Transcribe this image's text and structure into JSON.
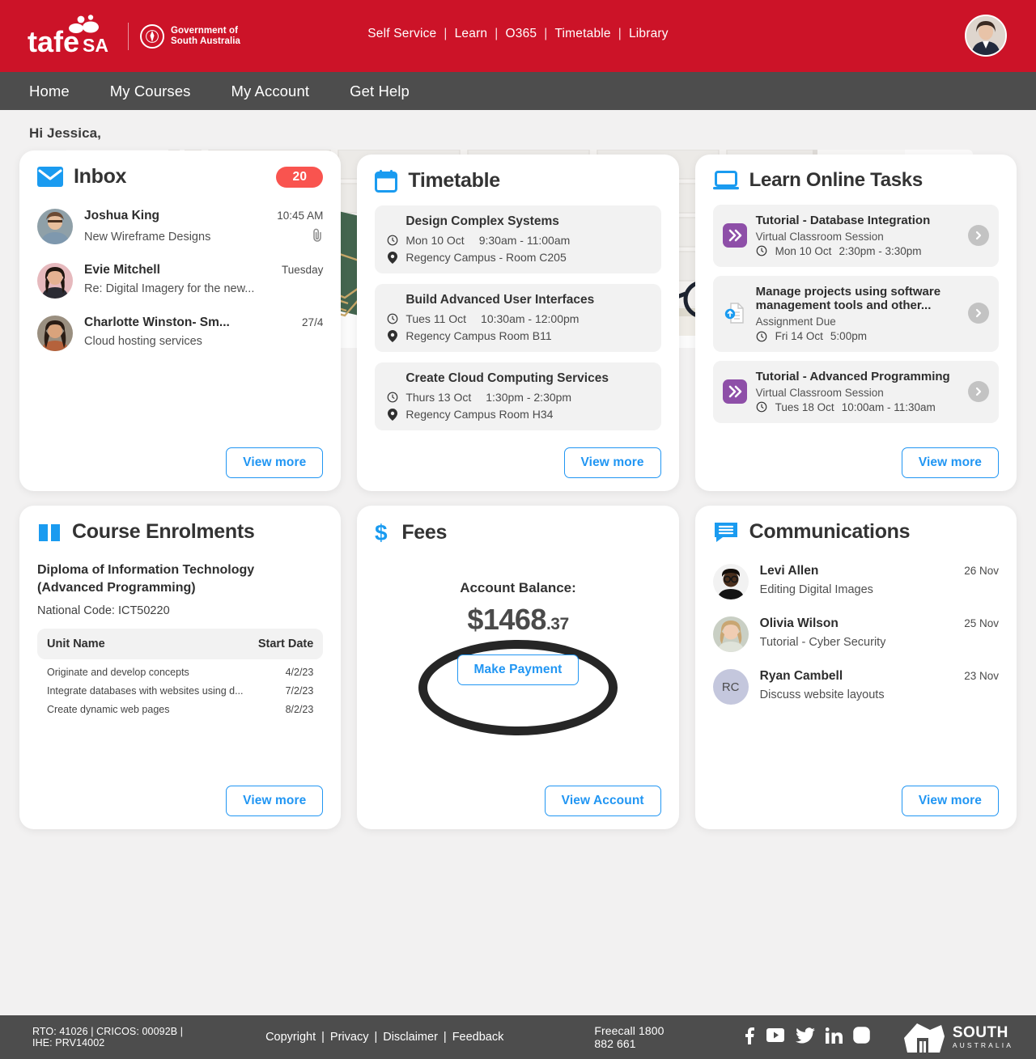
{
  "header": {
    "brand_name": "tafeSA",
    "gov_line1": "Government of",
    "gov_line2": "South Australia",
    "brand_red": "#cc1328",
    "quicklinks": [
      "Self Service",
      "Learn",
      "O365",
      "Timetable",
      "Library"
    ],
    "separator": "|",
    "avatar_icon": "user-avatar"
  },
  "nav": {
    "items": [
      "Home",
      "My Courses",
      "My Account",
      "Get Help"
    ]
  },
  "page": {
    "greeting": "Hi Jessica,"
  },
  "inbox": {
    "title": "Inbox",
    "icon": "envelope-icon",
    "badge": "20",
    "badge_color": "#f9544f",
    "messages": [
      {
        "name": "Joshua King",
        "subject": "New Wireframe Designs",
        "time": "10:45 AM",
        "attachment": true
      },
      {
        "name": "Evie Mitchell",
        "subject": "Re: Digital Imagery for the new...",
        "time": "Tuesday",
        "attachment": false
      },
      {
        "name": "Charlotte Winston- Sm...",
        "subject": "Cloud hosting services",
        "time": "27/4",
        "attachment": false
      }
    ],
    "view_more": "View more"
  },
  "timetable": {
    "title": "Timetable",
    "icon": "calendar-icon",
    "items": [
      {
        "name": "Design Complex Systems",
        "date": "Mon 10 Oct",
        "time": "9:30am - 11:00am",
        "location": "Regency Campus - Room C205"
      },
      {
        "name": "Build Advanced User Interfaces",
        "date": "Tues 11 Oct",
        "time": "10:30am - 12:00pm",
        "location": "Regency Campus Room B11"
      },
      {
        "name": "Create Cloud Computing Services",
        "date": "Thurs 13 Oct",
        "time": "1:30pm - 2:30pm",
        "location": "Regency Campus Room H34"
      }
    ],
    "view_more": "View more"
  },
  "learn_tasks": {
    "title": "Learn Online Tasks",
    "icon": "laptop-icon",
    "items": [
      {
        "title": "Tutorial - Database Integration",
        "subtitle": "Virtual Classroom Session",
        "date": "Mon 10 Oct",
        "time": "2:30pm - 3:30pm",
        "icon": "chevrons-purple-icon"
      },
      {
        "title": "Manage projects using software management tools and other...",
        "subtitle": "Assignment Due",
        "date": "Fri 14 Oct",
        "time": "5:00pm",
        "icon": "document-upload-icon"
      },
      {
        "title": "Tutorial - Advanced Programming",
        "subtitle": "Virtual Classroom Session",
        "date": "Tues 18 Oct",
        "time": "10:00am - 11:30am",
        "icon": "chevrons-purple-icon"
      }
    ],
    "view_more": "View more"
  },
  "enrolments": {
    "title": "Course Enrolments",
    "icon": "book-icon",
    "course_name": "Diploma of Information Technology (Advanced Programming)",
    "national_code": "National Code: ICT50220",
    "columns": [
      "Unit Name",
      "Start Date"
    ],
    "rows": [
      {
        "unit": "Originate and develop concepts",
        "start": "4/2/23"
      },
      {
        "unit": "Integrate databases with websites using d...",
        "start": "7/2/23"
      },
      {
        "unit": "Create dynamic web pages",
        "start": "8/2/23"
      }
    ],
    "view_more": "View more"
  },
  "fees": {
    "title": "Fees",
    "icon": "dollar-icon",
    "balance_label": "Account Balance:",
    "balance_dollars": "$1468",
    "balance_cents": ".37",
    "make_payment": "Make Payment",
    "view_account": "View Account",
    "highlight": "black-ellipse-annotation"
  },
  "communications": {
    "title": "Communications",
    "icon": "chat-bubble-icon",
    "messages": [
      {
        "name": "Levi Allen",
        "subject": "Editing Digital Images",
        "date": "26 Nov",
        "initials": ""
      },
      {
        "name": "Olivia Wilson",
        "subject": "Tutorial - Cyber Security",
        "date": "25 Nov",
        "initials": ""
      },
      {
        "name": "Ryan Cambell",
        "subject": "Discuss website layouts",
        "date": "23  Nov",
        "initials": "RC"
      }
    ],
    "view_more": "View more"
  },
  "footer": {
    "registration": "RTO: 41026 | CRICOS: 00092B | IHE: PRV14002",
    "links": [
      "Copyright",
      "Privacy",
      "Disclaimer",
      "Feedback"
    ],
    "separator": "|",
    "phone": "Freecall 1800 882 661",
    "social": [
      "facebook-icon",
      "youtube-icon",
      "twitter-icon",
      "linkedin-icon",
      "instagram-icon"
    ],
    "sa_line1": "SOUTH",
    "sa_line2": "AUSTRALIA"
  }
}
